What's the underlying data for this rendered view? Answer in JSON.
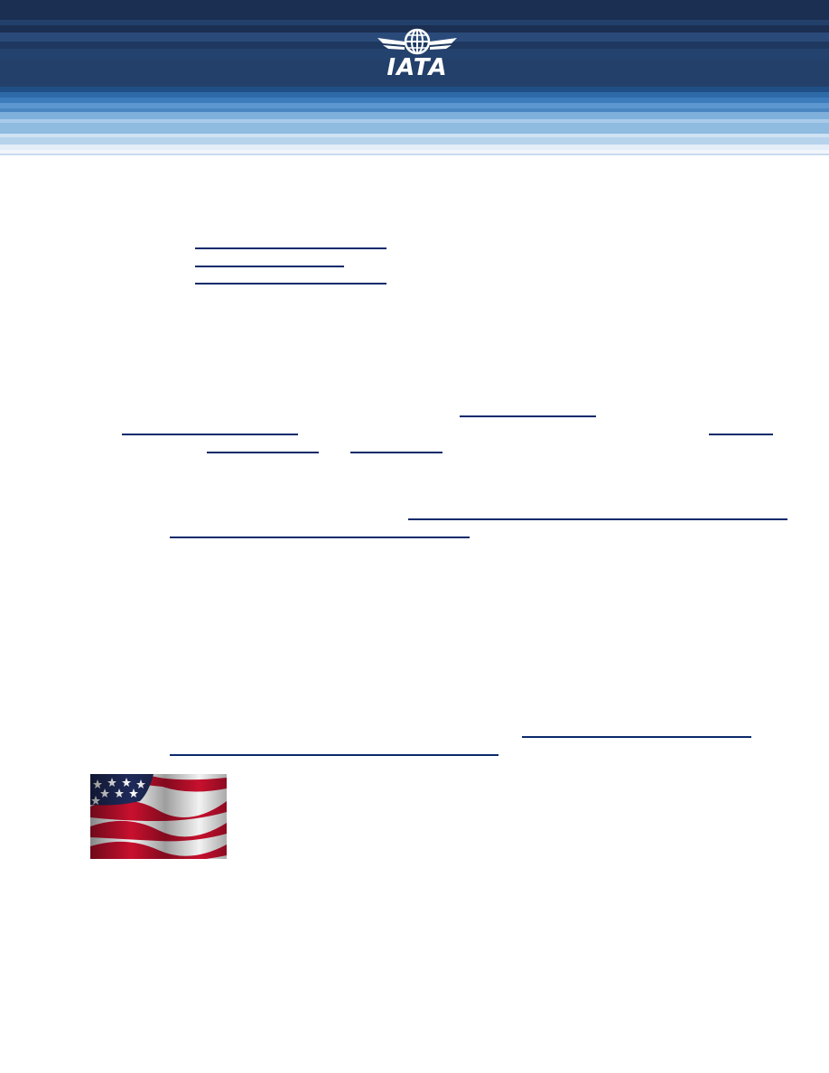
{
  "header": {
    "logo_text": "IATA",
    "colors": {
      "dark_navy": "#1b2f52",
      "mid_blue": "#2f5f9a",
      "light_blue": "#8fbbe0",
      "link_blue": "#0b2a6b"
    }
  },
  "links": {
    "note": ""
  },
  "flag": {
    "icon": "us-flag-image"
  }
}
